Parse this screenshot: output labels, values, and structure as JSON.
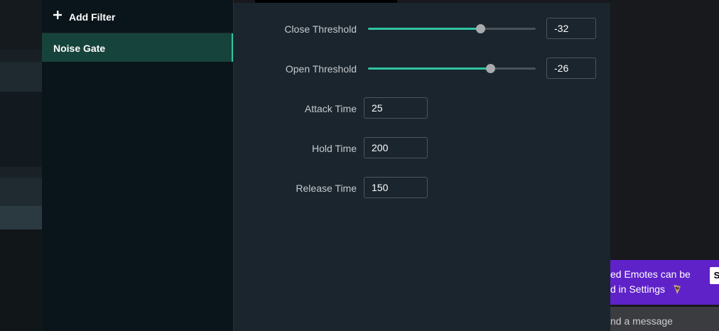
{
  "filter_panel": {
    "add_filter_label": "Add Filter",
    "filters": [
      {
        "label": "Noise Gate",
        "selected": true
      }
    ]
  },
  "settings": {
    "close_threshold": {
      "label": "Close Threshold",
      "value": "-32",
      "slider_fraction": 0.669
    },
    "open_threshold": {
      "label": "Open Threshold",
      "value": "-26",
      "slider_fraction": 0.729
    },
    "attack_time": {
      "label": "Attack Time",
      "value": "25"
    },
    "hold_time": {
      "label": "Hold Time",
      "value": "200"
    },
    "release_time": {
      "label": "Release Time",
      "value": "150"
    }
  },
  "background": {
    "promo_line1": "ed Emotes can be",
    "promo_line2": "d in Settings",
    "promo_button": "S",
    "chat_placeholder": "nd a message"
  },
  "colors": {
    "accent": "#31c3a2",
    "promo": "#5f22c9"
  }
}
